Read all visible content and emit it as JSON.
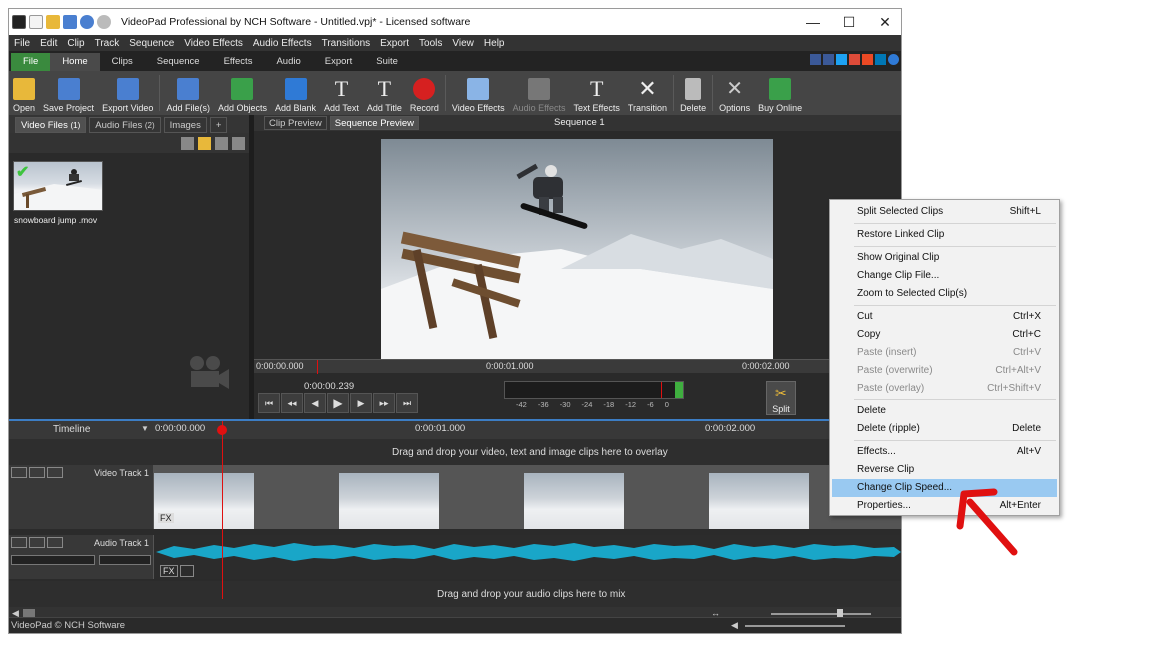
{
  "window": {
    "title": "VideoPad Professional by NCH Software - Untitled.vpj* - Licensed software",
    "controls": {
      "minimize": "—",
      "maximize": "☐",
      "close": "✕"
    }
  },
  "menubar": [
    "File",
    "Edit",
    "Clip",
    "Track",
    "Sequence",
    "Video Effects",
    "Audio Effects",
    "Transitions",
    "Export",
    "Tools",
    "View",
    "Help"
  ],
  "ribbon_tabs": [
    "File",
    "Home",
    "Clips",
    "Sequence",
    "Effects",
    "Audio",
    "Export",
    "Suite"
  ],
  "toolbar": {
    "items": [
      {
        "label": "Open",
        "icon": "open-folder-icon",
        "color": "#e8b83a"
      },
      {
        "label": "Save Project",
        "icon": "save-icon",
        "color": "#4a7fd0"
      },
      {
        "label": "Export Video",
        "icon": "export-video-icon",
        "color": "#4a7fd0"
      },
      {
        "label": "Add File(s)",
        "icon": "add-files-icon",
        "color": "#4a7fd0"
      },
      {
        "label": "Add Objects",
        "icon": "add-objects-icon",
        "color": "#3aa04a"
      },
      {
        "label": "Add Blank",
        "icon": "add-blank-icon",
        "color": "#2f7ad6"
      },
      {
        "label": "Add Text",
        "icon": "add-text-icon",
        "color": "#dddddd"
      },
      {
        "label": "Add Title",
        "icon": "add-title-icon",
        "color": "#dddddd"
      },
      {
        "label": "Record",
        "icon": "record-icon",
        "color": "#d62020"
      },
      {
        "label": "Video Effects",
        "icon": "video-effects-icon",
        "color": "#8ab4e6"
      },
      {
        "label": "Audio Effects",
        "icon": "audio-effects-icon",
        "color": "#8a8a8a"
      },
      {
        "label": "Text Effects",
        "icon": "text-effects-icon",
        "color": "#dddddd"
      },
      {
        "label": "Transition",
        "icon": "transition-icon",
        "color": "#dddddd"
      },
      {
        "label": "Delete",
        "icon": "trash-icon",
        "color": "#bbbbbb"
      },
      {
        "label": "Options",
        "icon": "options-tools-icon",
        "color": "#cccccc"
      },
      {
        "label": "Buy Online",
        "icon": "cart-icon",
        "color": "#3aa04a"
      }
    ]
  },
  "media_panel": {
    "tabs": [
      {
        "label": "Video Files",
        "count": "(1)"
      },
      {
        "label": "Audio Files",
        "count": "(2)"
      },
      {
        "label": "Images",
        "count": ""
      },
      {
        "label": "+",
        "count": ""
      }
    ],
    "file_name": "snowboard jump .mov"
  },
  "preview": {
    "tabs": [
      "Clip Preview",
      "Sequence Preview"
    ],
    "sequence_title": "Sequence 1",
    "ruler": [
      "0:00:00.000",
      "0:00:01.000",
      "0:00:02.000"
    ],
    "timecode": "0:00:00.239",
    "meter_labels": [
      "-42",
      "-36",
      "-30",
      "-24",
      "-18",
      "-12",
      "-6",
      "0"
    ],
    "split_label": "Split"
  },
  "timeline": {
    "label": "Timeline",
    "ticks": [
      "0:00:00.000",
      "0:00:01.000",
      "0:00:02.000"
    ],
    "overlay_hint": "Drag and drop your video, text and image clips here to overlay",
    "video_track": "Video Track 1",
    "audio_track": "Audio Track 1",
    "audio_hint": "Drag and drop your audio clips here to mix",
    "fx": "FX"
  },
  "status": "VideoPad © NCH Software",
  "context_menu": [
    {
      "label": "Split Selected Clips",
      "shortcut": "Shift+L",
      "disabled": false
    },
    {
      "label": "Restore Linked Clip",
      "shortcut": "",
      "disabled": false
    },
    {
      "label": "Show Original Clip",
      "shortcut": "",
      "disabled": false
    },
    {
      "label": "Change Clip File...",
      "shortcut": "",
      "disabled": false
    },
    {
      "label": "Zoom to Selected Clip(s)",
      "shortcut": "",
      "disabled": false
    },
    {
      "label": "Cut",
      "shortcut": "Ctrl+X",
      "disabled": false
    },
    {
      "label": "Copy",
      "shortcut": "Ctrl+C",
      "disabled": false
    },
    {
      "label": "Paste (insert)",
      "shortcut": "Ctrl+V",
      "disabled": true
    },
    {
      "label": "Paste (overwrite)",
      "shortcut": "Ctrl+Alt+V",
      "disabled": true
    },
    {
      "label": "Paste (overlay)",
      "shortcut": "Ctrl+Shift+V",
      "disabled": true
    },
    {
      "label": "Delete",
      "shortcut": "",
      "disabled": false
    },
    {
      "label": "Delete (ripple)",
      "shortcut": "Delete",
      "disabled": false
    },
    {
      "label": "Effects...",
      "shortcut": "Alt+V",
      "disabled": false
    },
    {
      "label": "Reverse Clip",
      "shortcut": "",
      "disabled": false
    },
    {
      "label": "Change Clip Speed...",
      "shortcut": "",
      "disabled": false,
      "highlighted": true
    },
    {
      "label": "Properties...",
      "shortcut": "Alt+Enter",
      "disabled": false
    }
  ],
  "colors": {
    "accent_green": "#3a8a3e",
    "playhead": "#e01010",
    "audio_wave": "#19a6c8",
    "menu_highlight": "#99c9f1",
    "annotation_arrow": "#e01010"
  }
}
